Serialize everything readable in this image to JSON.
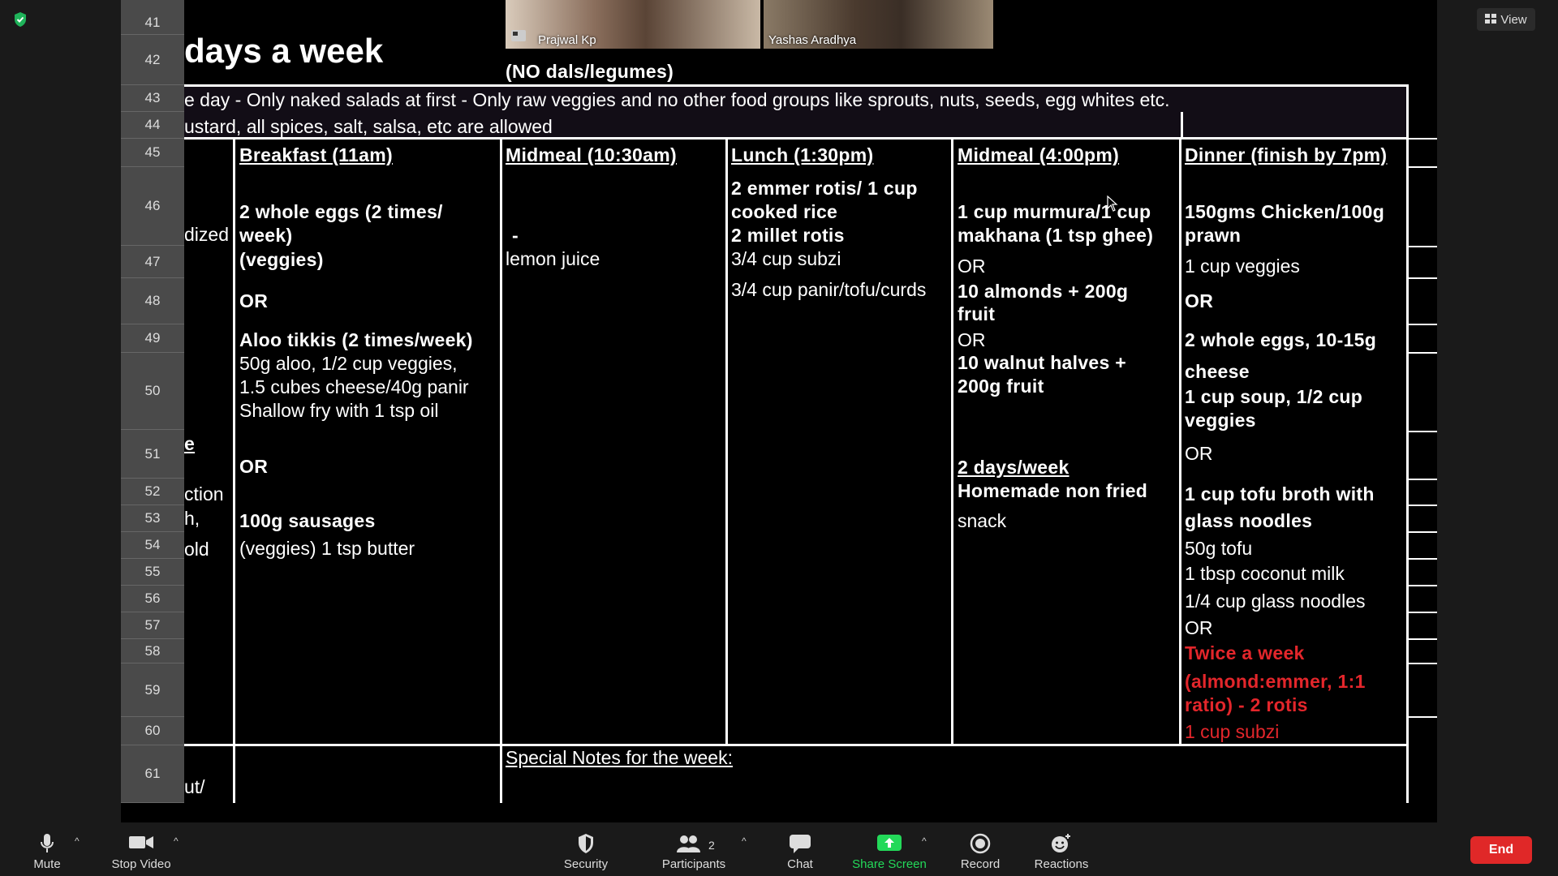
{
  "meeting": {
    "participants": [
      {
        "name": "Prajwal Kp"
      },
      {
        "name": "Yashas Aradhya"
      }
    ],
    "view_label": "View"
  },
  "sheet": {
    "row_numbers": [
      "41",
      "42",
      "43",
      "44",
      "45",
      "46",
      "47",
      "48",
      "49",
      "50",
      "51",
      "52",
      "53",
      "54",
      "55",
      "56",
      "57",
      "58",
      "59",
      "60",
      "61"
    ],
    "title": "days a week",
    "subtitle": "(NO dals/legumes)",
    "note_line1": "e day - Only naked salads at first - Only raw veggies and no other food groups like sprouts, nuts, seeds, egg whites etc.",
    "note_line2": "ustard, all spices, salt, salsa, etc are allowed",
    "left_col": {
      "r1": "dized",
      "r2": "e",
      "r3": "ction",
      "r4": "h,",
      "r5": "old",
      "r6": "ut/"
    },
    "breakfast": {
      "header": "Breakfast (11am)",
      "l1": "2 whole eggs (2 times/",
      "l2": "week)",
      "l3": "(veggies)",
      "or1": "OR",
      "l4": "Aloo tikkis (2 times/week)",
      "l5": "50g aloo, 1/2 cup veggies,",
      "l6": "1.5 cubes cheese/40g panir",
      "l7": "Shallow fry with 1 tsp oil",
      "or2": "OR",
      "l8": "100g sausages",
      "l9": "(veggies) 1 tsp butter"
    },
    "midmeal1": {
      "header": "Midmeal (10:30am)",
      "l1": "-",
      "l2": "lemon juice",
      "special_notes": "Special Notes for the week:"
    },
    "lunch": {
      "header": "Lunch (1:30pm)",
      "l1": "2 emmer rotis/ 1 cup",
      "l2": "cooked rice",
      "l3": "2 millet rotis",
      "l4": "3/4 cup subzi",
      "l5": "3/4 cup panir/tofu/curds"
    },
    "midmeal2": {
      "header": "Midmeal (4:00pm)",
      "l1": "1 cup murmura/1 cup",
      "l2": "makhana (1 tsp ghee)",
      "or1": "OR",
      "l3": "10 almonds + 200g",
      "l4": "fruit",
      "or2": "OR",
      "l5": "10 walnut halves +",
      "l6": "200g fruit",
      "l7": "2 days/week",
      "l8": "Homemade non fried",
      "l9": "snack"
    },
    "dinner": {
      "header": "Dinner (finish by 7pm)",
      "l1": "150gms Chicken/100g",
      "l2": "prawn",
      "l3": "1 cup veggies",
      "or1": "OR",
      "l4": "2 whole eggs, 10-15g",
      "l5": "cheese",
      "l6": "1 cup soup, 1/2 cup",
      "l7": "veggies",
      "or2": "OR",
      "l8": "1 cup tofu broth with",
      "l9": "glass noodles",
      "l10": "50g tofu",
      "l11": "1 tbsp coconut milk",
      "l12": "1/4 cup glass noodles",
      "or3": "OR",
      "l13": "Twice a week",
      "l14": "(almond:emmer, 1:1",
      "l15": "ratio) - 2 rotis",
      "l16": "1 cup subzi"
    }
  },
  "toolbar": {
    "mute": "Mute",
    "stop_video": "Stop Video",
    "security": "Security",
    "participants": "Participants",
    "participants_count": "2",
    "chat": "Chat",
    "share_screen": "Share Screen",
    "record": "Record",
    "reactions": "Reactions",
    "end": "End"
  },
  "colors": {
    "share_green": "#23d959",
    "end_red": "#e02828",
    "highlight_red": "#e3262b",
    "shield_green": "#1fb35a"
  }
}
